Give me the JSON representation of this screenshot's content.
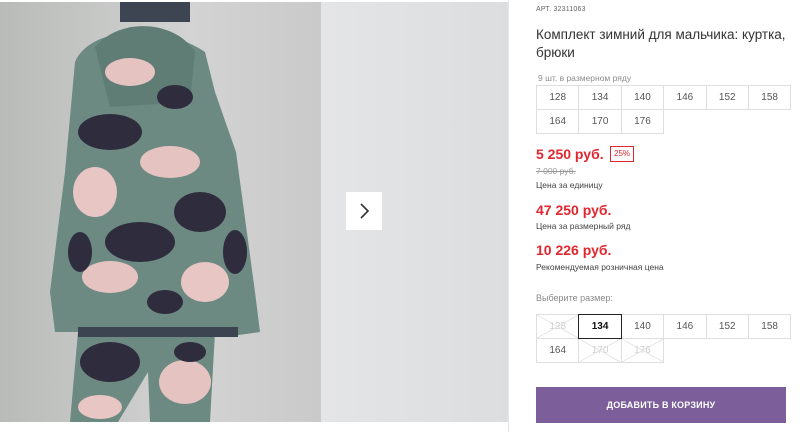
{
  "gallery": {
    "main_photo_icon": "product-photo",
    "next_arrow_icon": "chevron-right-icon"
  },
  "product": {
    "article_label": "АРТ.",
    "article_number": "32311063",
    "title": "Комплект зимний для мальчика: куртка, брюки",
    "pack_label": "9 шт. в размерном ряду",
    "pack_sizes": [
      "128",
      "134",
      "140",
      "146",
      "152",
      "158",
      "164",
      "170",
      "176"
    ],
    "price": "5 250 руб.",
    "discount": "25%",
    "old_price": "7 000 руб.",
    "price_note": "Цена за единицу",
    "pack_price": "47 250 руб.",
    "pack_price_note": "Цена за размерный ряд",
    "retail_price": "10 226 руб.",
    "retail_price_note": "Рекомендуемая розничная цена",
    "choose_size_label": "Выберите размер:",
    "size_options": [
      {
        "label": "128",
        "state": "disabled"
      },
      {
        "label": "134",
        "state": "active"
      },
      {
        "label": "140",
        "state": "available"
      },
      {
        "label": "146",
        "state": "available"
      },
      {
        "label": "152",
        "state": "available"
      },
      {
        "label": "158",
        "state": "available"
      },
      {
        "label": "164",
        "state": "available"
      },
      {
        "label": "170",
        "state": "disabled"
      },
      {
        "label": "176",
        "state": "disabled"
      }
    ],
    "add_to_cart_label": "ДОБАВИТЬ В КОРЗИНУ"
  },
  "colors": {
    "accent": "#7b5e9a",
    "price_red": "#e0262f"
  }
}
